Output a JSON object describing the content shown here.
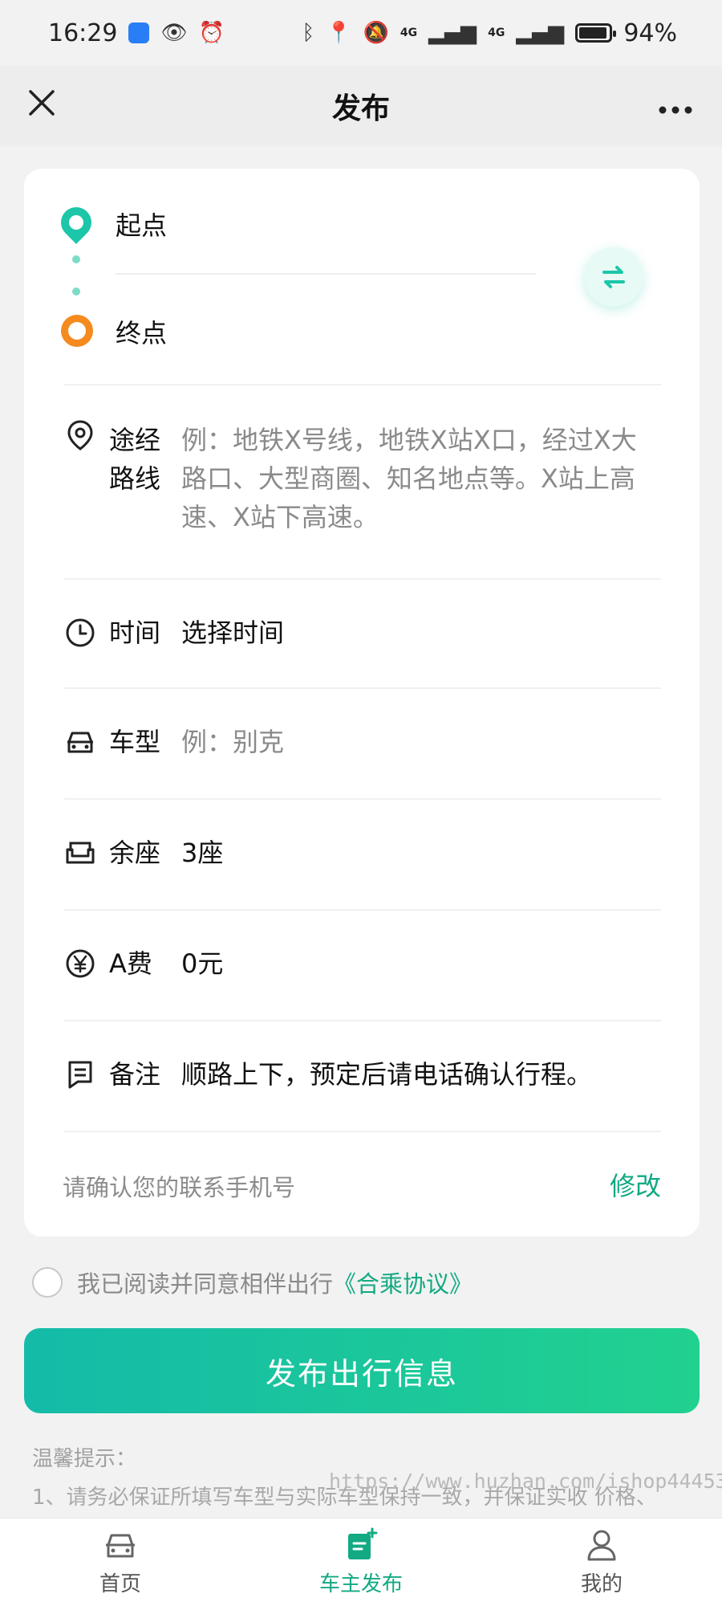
{
  "status_bar": {
    "time": "16:29",
    "battery": "94%",
    "battery_level": 0.94,
    "network_1": "4G",
    "network_2": "4G"
  },
  "nav": {
    "title": "发布",
    "close_icon": "close-icon",
    "more_icon": "more-icon"
  },
  "route": {
    "start_label": "起点",
    "end_label": "终点"
  },
  "fields": {
    "waypoints": {
      "label_line1": "途经",
      "label_line2": "路线",
      "placeholder": "例：地铁X号线，地铁X站X口，经过X大路口、大型商圈、知名地点等。X站上高速、X站下高速。"
    },
    "time": {
      "label": "时间",
      "value": "选择时间"
    },
    "car_model": {
      "label": "车型",
      "placeholder": "例：别克"
    },
    "seats": {
      "label": "余座",
      "value": "3座"
    },
    "fee": {
      "label": "A费",
      "value": "0元"
    },
    "note": {
      "label": "备注",
      "value": "顺路上下，预定后请电话确认行程。"
    }
  },
  "contact": {
    "prompt": "请确认您的联系手机号",
    "edit": "修改"
  },
  "agreement": {
    "text": "我已阅读并同意相伴出行",
    "link": "《合乘协议》",
    "checked": false
  },
  "publish_button": "发布出行信息",
  "tips": {
    "title": "温馨提示：",
    "line1": "1、请务必保证所填写车型与实际车型保持一致，并保证实收 价格、"
  },
  "watermark": "https://www.huzhan.com/ishop44453",
  "tabs": [
    {
      "label": "首页",
      "icon": "car-icon",
      "active": false
    },
    {
      "label": "车主发布",
      "icon": "publish-doc-icon",
      "active": true
    },
    {
      "label": "我的",
      "icon": "user-icon",
      "active": false
    }
  ],
  "colors": {
    "accent": "#13a983",
    "start_pin": "#1cc6a8",
    "end_pin": "#f58a1f",
    "button_from": "#14bba8",
    "button_to": "#21d18f"
  }
}
